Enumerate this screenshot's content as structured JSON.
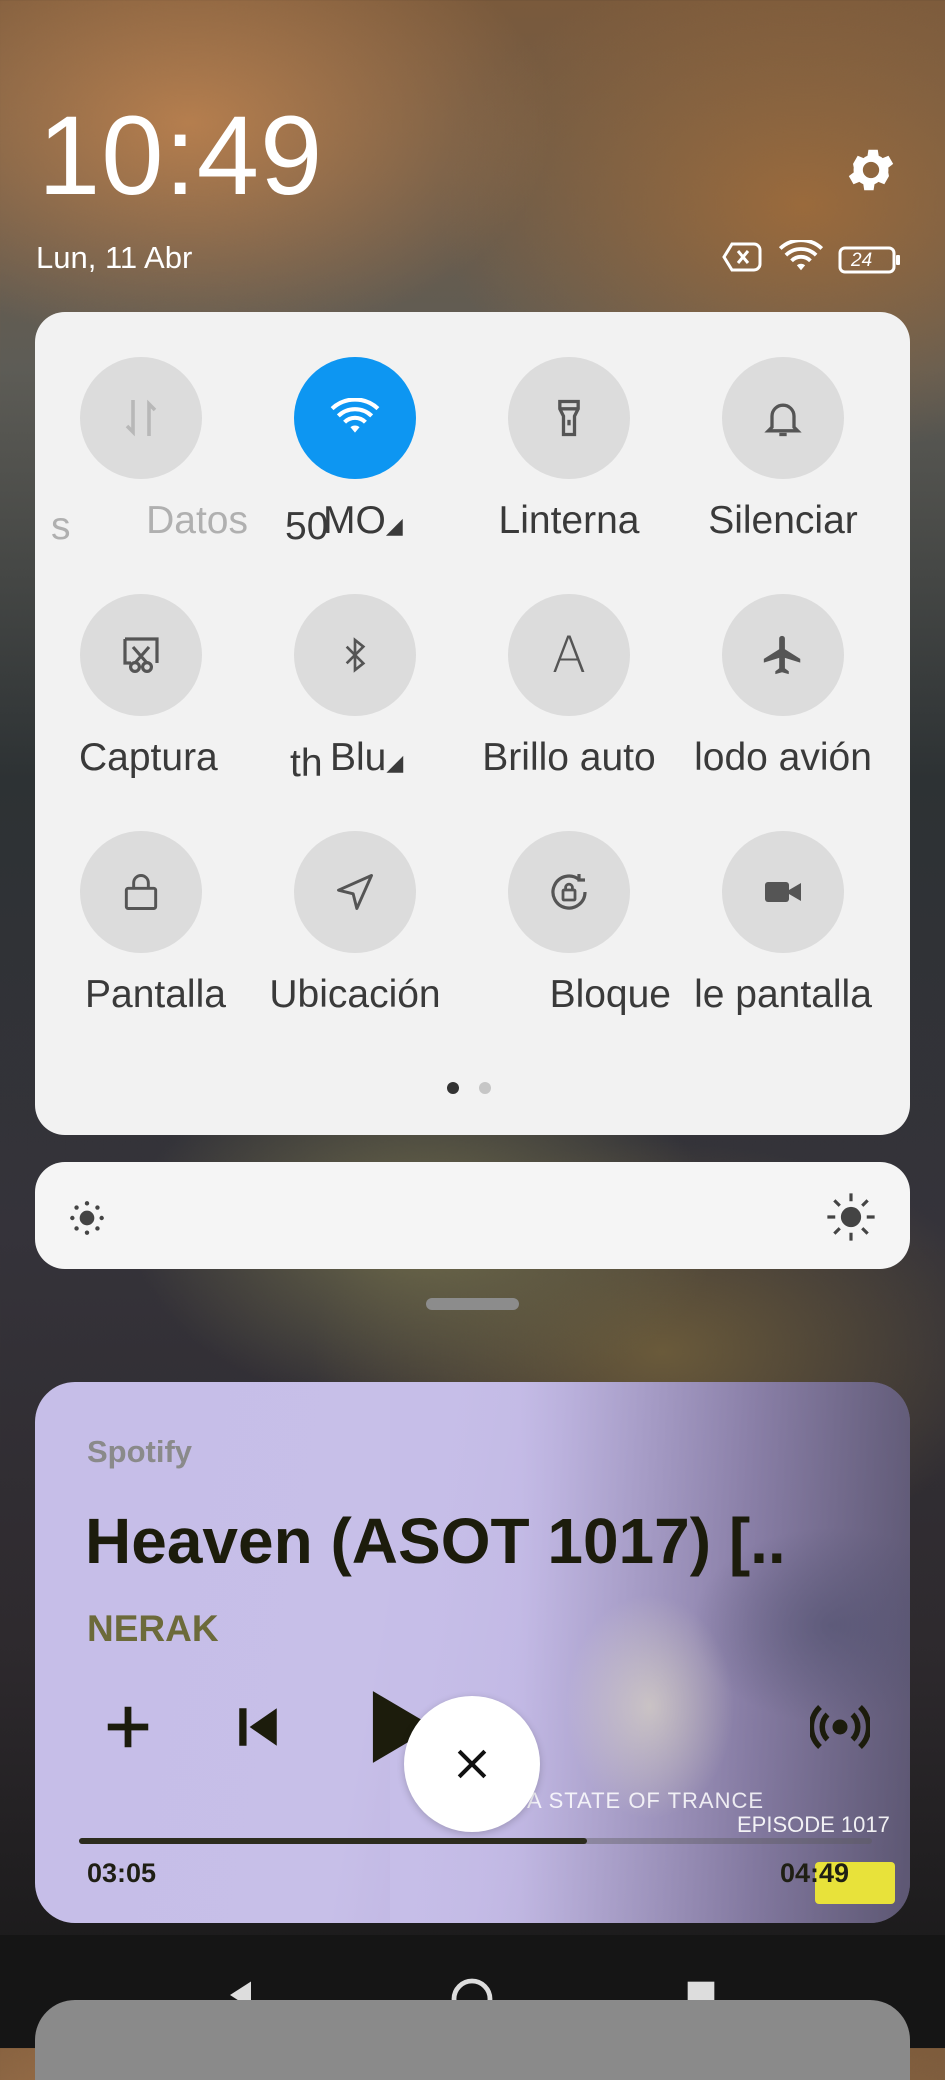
{
  "status": {
    "time": "10:49",
    "date": "Lun, 11 Abr",
    "battery": "24",
    "icons": [
      "sim-off-icon",
      "wifi-icon",
      "battery-icon"
    ]
  },
  "quick_settings": {
    "tiles": [
      {
        "label": "Datos",
        "icon": "data-icon",
        "active": false,
        "dim": true
      },
      {
        "label": "MO",
        "icon": "wifi-icon",
        "active": true
      },
      {
        "label": "Linterna",
        "icon": "flashlight-icon",
        "active": false
      },
      {
        "label": "Silenciar",
        "icon": "bell-icon",
        "active": false
      },
      {
        "label": "Captura",
        "icon": "screenshot-icon",
        "active": false
      },
      {
        "label": "Blu",
        "icon": "bluetooth-icon",
        "active": false
      },
      {
        "label": "Brillo auto",
        "icon": "auto-brightness-icon",
        "active": false
      },
      {
        "label": "lodo avión",
        "icon": "airplane-icon",
        "active": false
      },
      {
        "label": "Pantalla",
        "icon": "lock-icon",
        "active": false
      },
      {
        "label": "Ubicación",
        "icon": "location-icon",
        "active": false
      },
      {
        "label": "Bloque",
        "icon": "rotation-lock-icon",
        "active": false
      },
      {
        "label": "le pantalla",
        "icon": "video-icon",
        "active": false
      }
    ],
    "page_count": 2,
    "current_page": 1
  },
  "brightness": {
    "level": 0.0
  },
  "media": {
    "app": "Spotify",
    "title": "Heaven (ASOT 1017) [..",
    "artist": "NERAK",
    "elapsed": "03:05",
    "duration": "04:49",
    "progress": 0.64,
    "art_text_1": "A STATE OF TRANCE",
    "art_text_2": "EPISODE 1017"
  },
  "colors": {
    "accent": "#0d96f2"
  }
}
